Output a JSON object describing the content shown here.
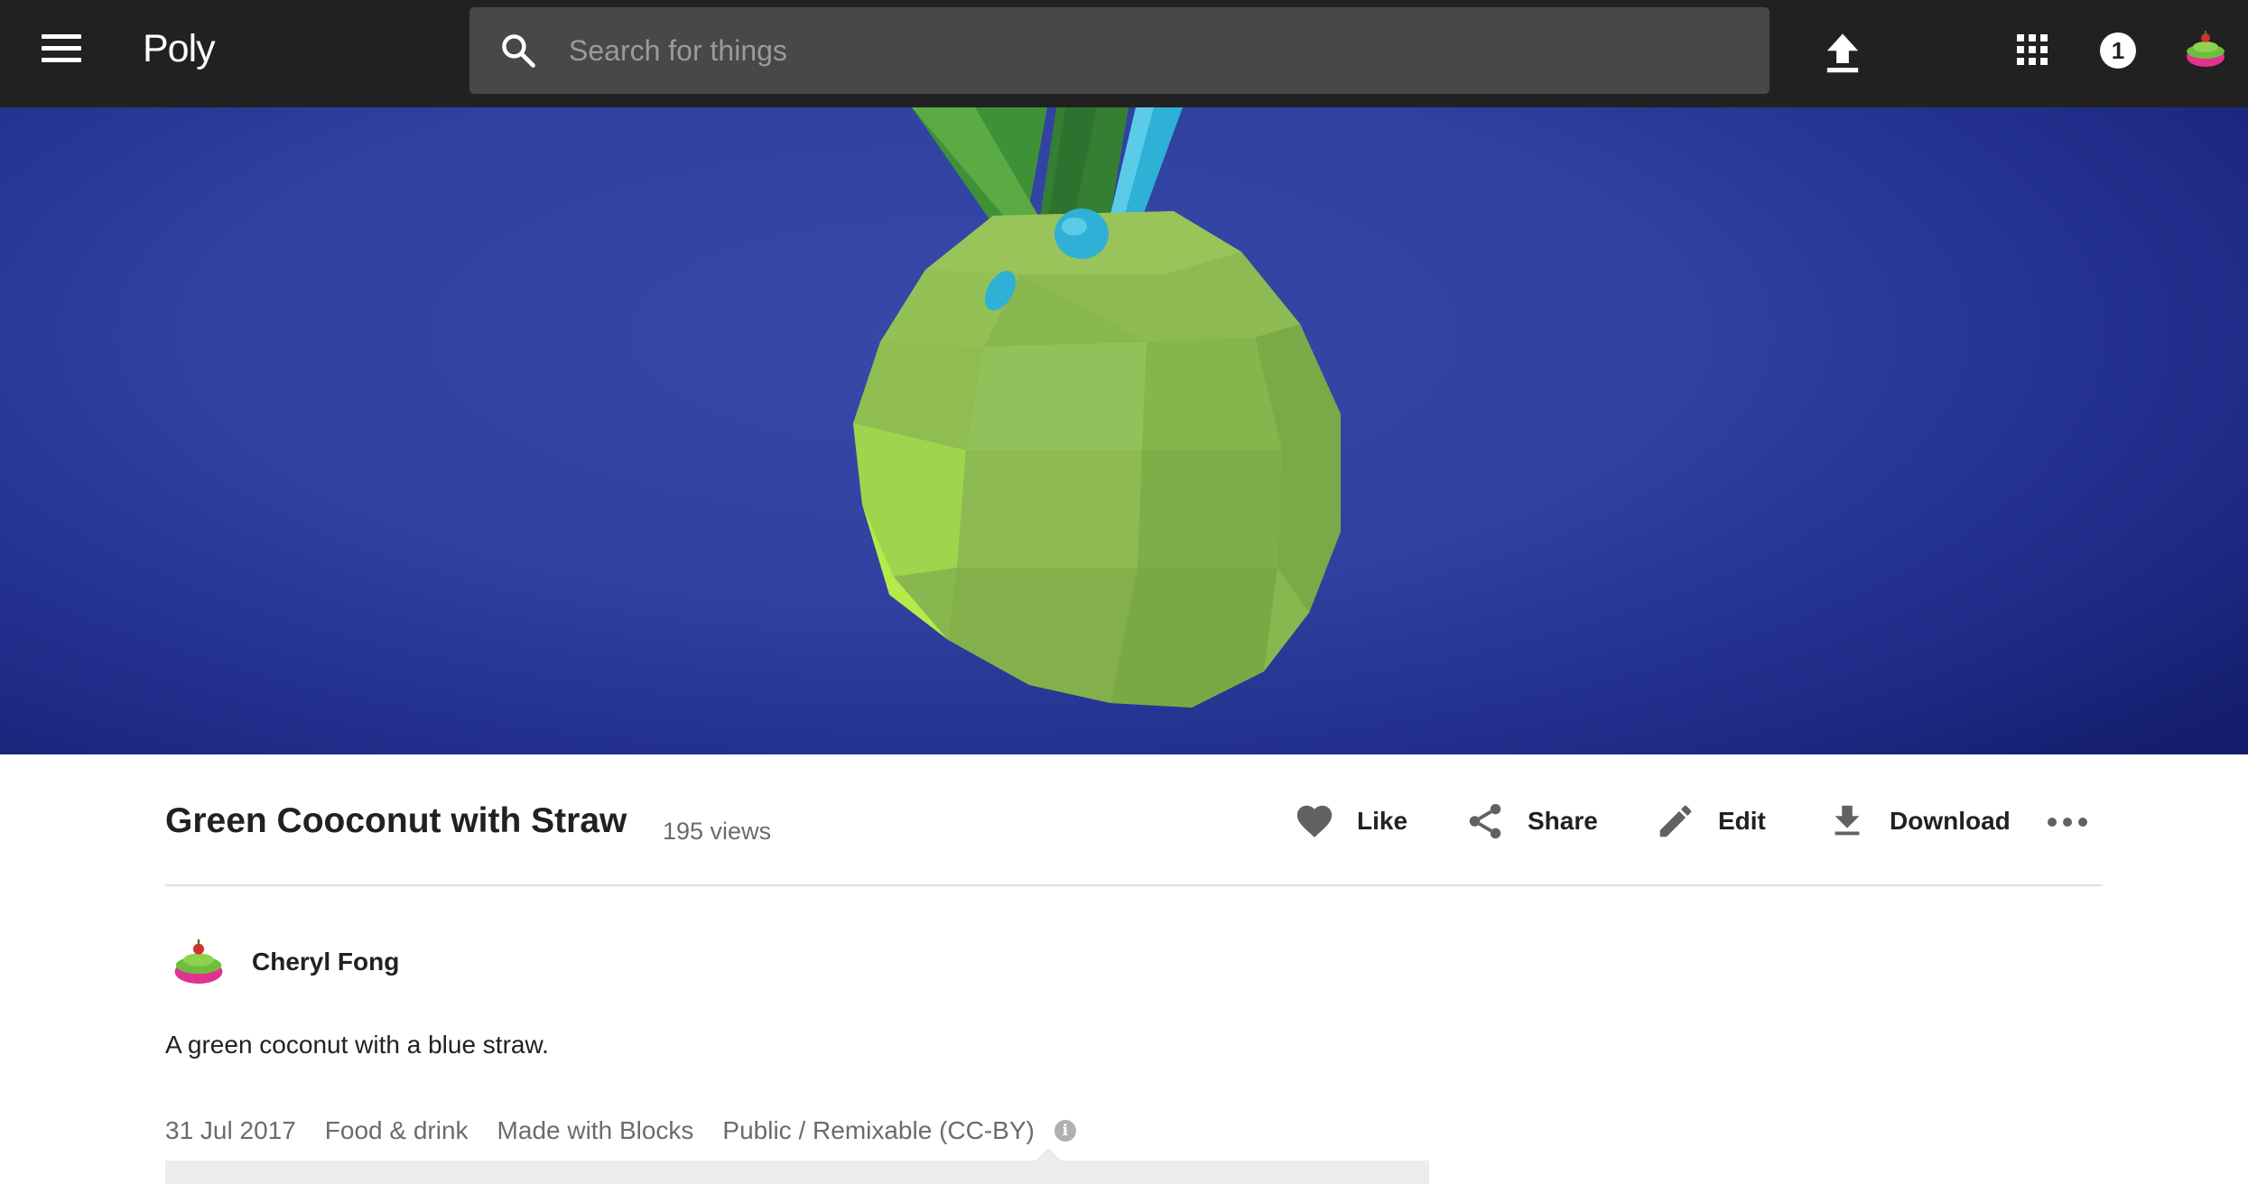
{
  "app": {
    "logo": "Poly"
  },
  "search": {
    "placeholder": "Search for things"
  },
  "header": {
    "notification_count": "1"
  },
  "asset": {
    "title": "Green Cooconut with Straw",
    "views": "195 views",
    "description": "A green coconut with a blue straw."
  },
  "actions": {
    "like": "Like",
    "share": "Share",
    "edit": "Edit",
    "download": "Download"
  },
  "author": {
    "name": "Cheryl Fong"
  },
  "meta": {
    "date": "31 Jul 2017",
    "category": "Food & drink",
    "made_with": "Made with Blocks",
    "license": "Public / Remixable (CC-BY)",
    "info_glyph": "i"
  },
  "colors": {
    "topbar": "#212121",
    "hero_background": "#2f40a0",
    "coconut": "#8ab84f",
    "leaf": "#4e9a3a",
    "straw": "#2fb0d6"
  },
  "icons": {
    "menu": "menu-icon",
    "search": "search-icon",
    "upload": "upload-icon",
    "apps": "apps-grid-icon",
    "avatar": "avatar-icon",
    "like": "heart-icon",
    "share": "share-icon",
    "edit": "pencil-icon",
    "download": "download-icon",
    "more": "more-horizontal-icon",
    "info": "info-icon"
  }
}
